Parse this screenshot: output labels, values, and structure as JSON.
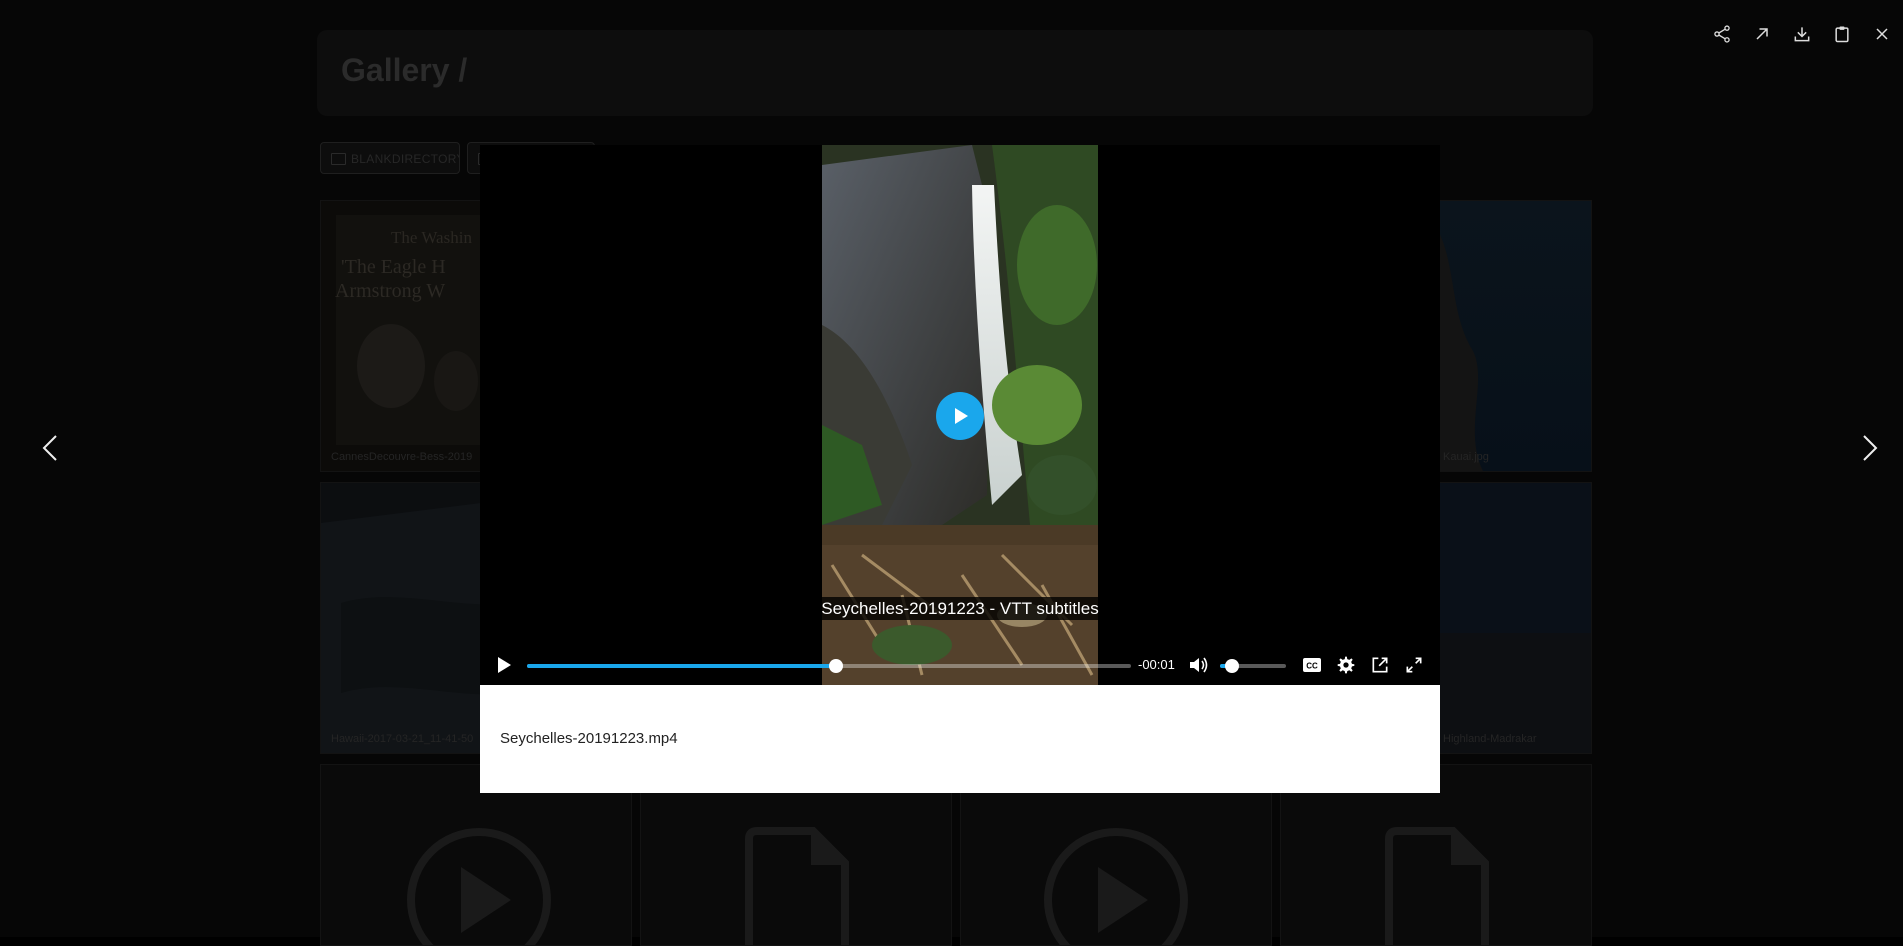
{
  "gallery": {
    "breadcrumb": "Gallery /",
    "directories": [
      "BLANKDIRECTORY"
    ],
    "tiles": [
      {
        "caption": "CannesDecouvre-Bess-2019",
        "kind": "newspaper"
      },
      {
        "caption": "Kauai.jpg",
        "kind": "photo"
      },
      {
        "caption": "Hawaii-2017-03-21_11-41-50",
        "kind": "photo"
      },
      {
        "caption": "Highland-Madrakar",
        "kind": "photo"
      },
      {
        "caption": "",
        "kind": "video"
      },
      {
        "caption": "",
        "kind": "file"
      },
      {
        "caption": "",
        "kind": "video"
      },
      {
        "caption": "",
        "kind": "file"
      }
    ],
    "newspaper_text": {
      "masthead": "The Washin",
      "headline_1": "'The Eagle H",
      "headline_2": "Armstrong W"
    }
  },
  "toolbar": {
    "share_icon": "share-icon",
    "open_icon": "open-in-new-icon",
    "download_icon": "download-icon",
    "copy_icon": "clipboard-icon",
    "close_icon": "close-icon"
  },
  "nav": {
    "prev_icon": "chevron-left-icon",
    "next_icon": "chevron-right-icon"
  },
  "lightbox": {
    "subtitle_text": "Seychelles-20191223 - VTT subtitles",
    "time_remaining": "-00:01",
    "progress_fraction": 0.512,
    "volume_fraction": 0.18,
    "caption": "Seychelles-20191223.mp4",
    "accent_color": "#1aa7ec"
  }
}
